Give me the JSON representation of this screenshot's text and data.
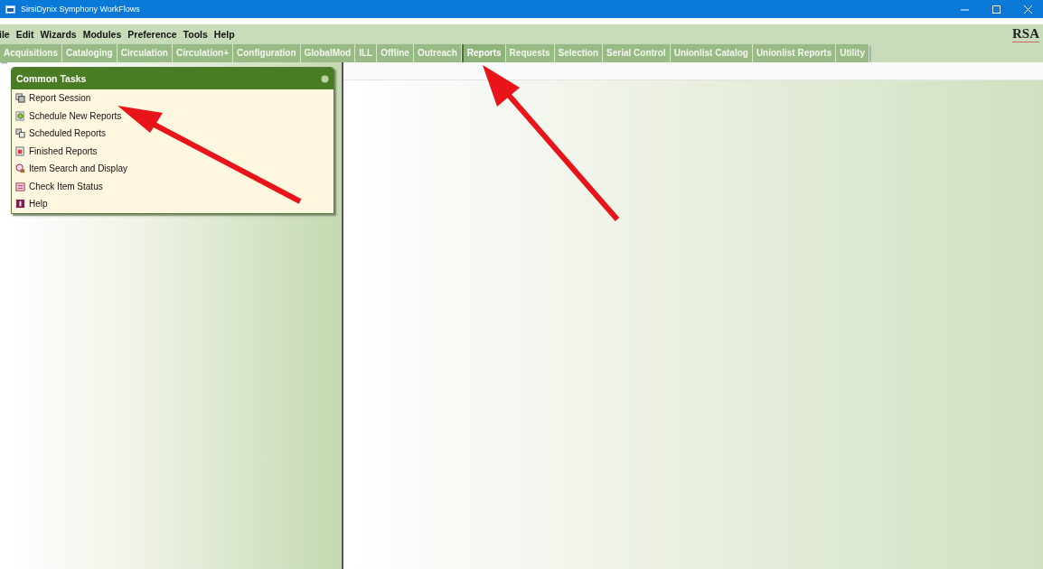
{
  "window": {
    "title": "SirsiDynix Symphony WorkFlows"
  },
  "menu": [
    "ile",
    "Edit",
    "Wizards",
    "Modules",
    "Preference",
    "Tools",
    "Help"
  ],
  "logo": "RSA",
  "tabs": [
    {
      "label": "Acquisitions",
      "selected": false
    },
    {
      "label": "Cataloging",
      "selected": false
    },
    {
      "label": "Circulation",
      "selected": false
    },
    {
      "label": "Circulation+",
      "selected": false
    },
    {
      "label": "Configuration",
      "selected": false
    },
    {
      "label": "GlobalMod",
      "selected": false
    },
    {
      "label": "ILL",
      "selected": false
    },
    {
      "label": "Offline",
      "selected": false
    },
    {
      "label": "Outreach",
      "selected": false
    },
    {
      "label": "Reports",
      "selected": true
    },
    {
      "label": "Requests",
      "selected": false
    },
    {
      "label": "Selection",
      "selected": false
    },
    {
      "label": "Serial Control",
      "selected": false
    },
    {
      "label": "Unionlist Catalog",
      "selected": false
    },
    {
      "label": "Unionlist Reports",
      "selected": false
    },
    {
      "label": "Utility",
      "selected": false
    }
  ],
  "common_tasks": {
    "title": "Common Tasks",
    "items": [
      {
        "label": "Report Session",
        "kind": "session"
      },
      {
        "label": "Schedule New Reports",
        "kind": "schedule"
      },
      {
        "label": "Scheduled Reports",
        "kind": "scheduled"
      },
      {
        "label": "Finished Reports",
        "kind": "finished"
      },
      {
        "label": "Item Search and Display",
        "kind": "search"
      },
      {
        "label": "Check Item Status",
        "kind": "status"
      },
      {
        "label": "Help",
        "kind": "help"
      }
    ]
  }
}
